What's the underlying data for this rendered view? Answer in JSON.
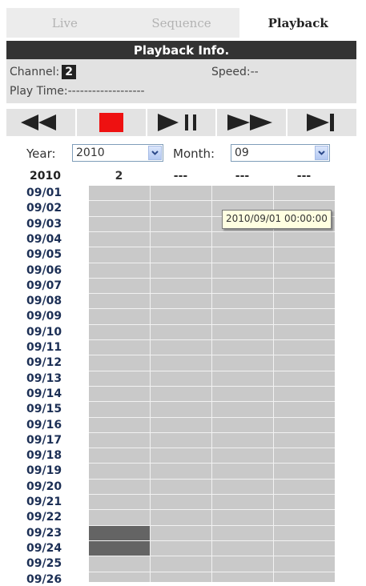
{
  "tabs": [
    {
      "label": "Live",
      "active": false
    },
    {
      "label": "Sequence",
      "active": false
    },
    {
      "label": "Playback",
      "active": true
    }
  ],
  "playback_info": {
    "header": "Playback Info.",
    "channel_label": "Channel:",
    "channel_value": "2",
    "speed_label": "Speed:",
    "speed_value": "--",
    "play_time_label": "Play Time:",
    "play_time_value": "-------------------"
  },
  "controls": [
    {
      "icon": "rewind-icon"
    },
    {
      "icon": "stop-icon"
    },
    {
      "icon": "play-pause-icon"
    },
    {
      "icon": "fast-forward-icon"
    },
    {
      "icon": "next-frame-icon"
    }
  ],
  "selectors": {
    "year_label": "Year:",
    "year_value": "2010",
    "month_label": "Month:",
    "month_value": "09"
  },
  "grid": {
    "year": "2010",
    "channels": [
      "2",
      "---",
      "---",
      "---"
    ],
    "days": [
      "09/01",
      "09/02",
      "09/03",
      "09/04",
      "09/05",
      "09/06",
      "09/07",
      "09/08",
      "09/09",
      "09/10",
      "09/11",
      "09/12",
      "09/13",
      "09/14",
      "09/15",
      "09/16",
      "09/17",
      "09/18",
      "09/19",
      "09/20",
      "09/21",
      "09/22",
      "09/23",
      "09/24",
      "09/25",
      "09/26"
    ],
    "recorded": [
      {
        "day": "09/23",
        "channel": 0
      },
      {
        "day": "09/24",
        "channel": 0
      }
    ]
  },
  "tooltip": "2010/09/01 00:00:00",
  "colors": {
    "stop": "#ee1111",
    "header_bg": "#333333",
    "grid_cell": "#c9c9c9",
    "recorded_cell": "#646464"
  }
}
